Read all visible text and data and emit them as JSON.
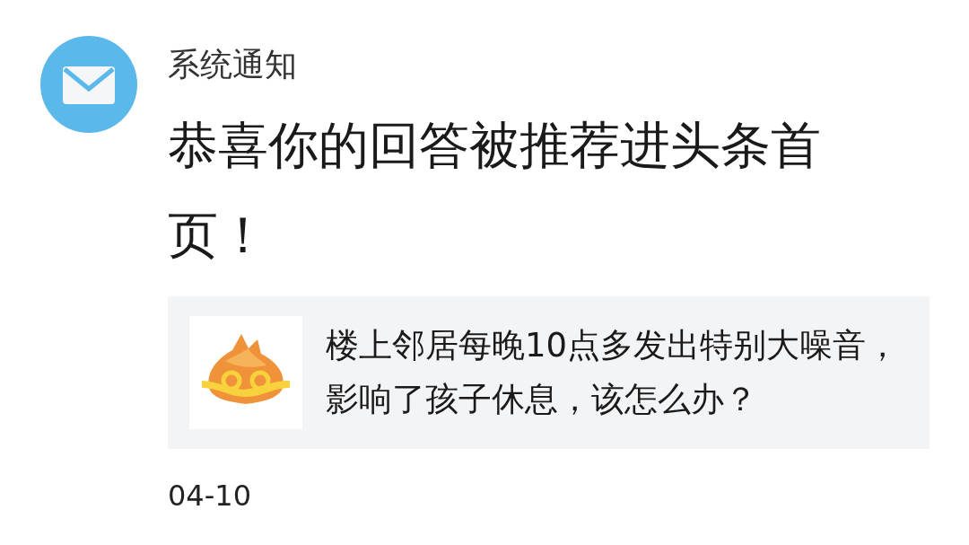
{
  "notification": {
    "sender": "系统通知",
    "title": "恭喜你的回答被推荐进头条首页！",
    "card": {
      "text": "楼上邻居每晚10点多发出特别大噪音，影响了孩子休息，该怎么办？"
    },
    "date": "04-10"
  }
}
